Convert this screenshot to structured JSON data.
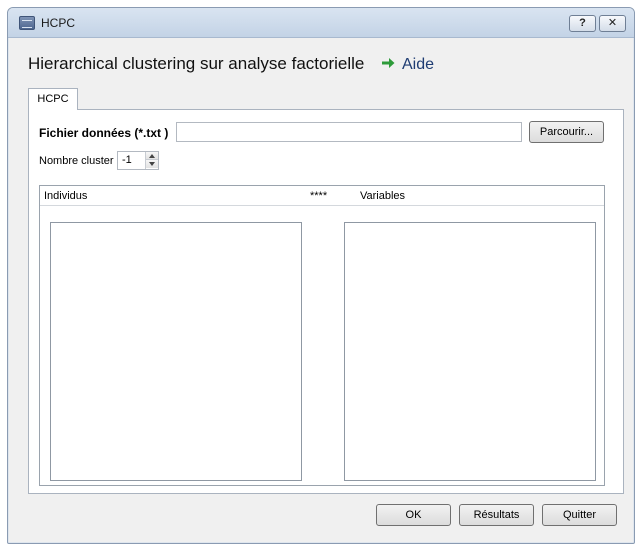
{
  "window": {
    "title": "HCPC",
    "help_label": "?",
    "close_label": "✕"
  },
  "header": {
    "title": "Hierarchical clustering  sur analyse factorielle",
    "aide_label": "Aide"
  },
  "tabs": [
    {
      "label": "HCPC"
    }
  ],
  "form": {
    "file_label": "Fichier données (*.txt )",
    "file_value": "",
    "browse_label": "Parcourir...",
    "cluster_label": "Nombre cluster",
    "cluster_value": "-1"
  },
  "lists": {
    "individus_header": "Individus",
    "separator": "****",
    "variables_header": "Variables"
  },
  "footer": {
    "ok_label": "OK",
    "results_label": "Résultats",
    "quit_label": "Quitter"
  },
  "colors": {
    "accent_arrow": "#2e9b3a",
    "aide_text": "#1e3c72"
  }
}
